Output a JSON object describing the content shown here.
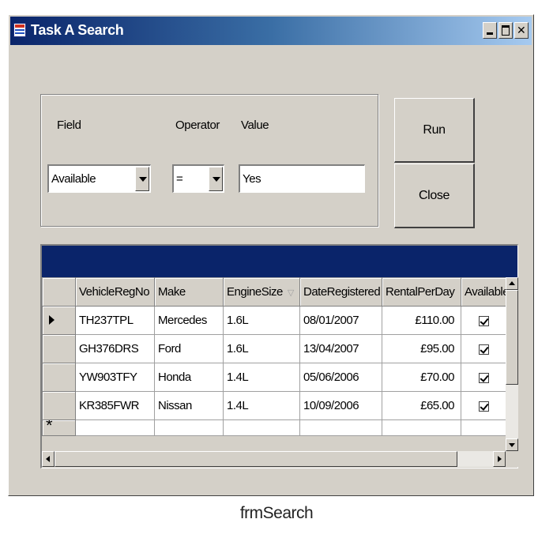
{
  "window": {
    "title": "Task A Search",
    "caption_below": "frmSearch"
  },
  "criteria": {
    "field_label": "Field",
    "operator_label": "Operator",
    "value_label": "Value",
    "field_value": "Available",
    "operator_value": "=",
    "value_value": "Yes"
  },
  "buttons": {
    "run_label": "Run",
    "close_label": "Close"
  },
  "grid": {
    "columns": [
      "VehicleRegNo",
      "Make",
      "EngineSize",
      "DateRegistered",
      "RentalPerDay",
      "Available"
    ],
    "sorted_column": "EngineSize",
    "rows": [
      {
        "reg": "TH237TPL",
        "make": "Mercedes",
        "engine": "1.6L",
        "date": "08/01/2007",
        "rental": "£110.00",
        "available": true
      },
      {
        "reg": "GH376DRS",
        "make": "Ford",
        "engine": "1.6L",
        "date": "13/04/2007",
        "rental": "£95.00",
        "available": true
      },
      {
        "reg": "YW903TFY",
        "make": "Honda",
        "engine": "1.4L",
        "date": "05/06/2006",
        "rental": "£70.00",
        "available": true
      },
      {
        "reg": "KR385FWR",
        "make": "Nissan",
        "engine": "1.4L",
        "date": "10/09/2006",
        "rental": "£65.00",
        "available": true
      }
    ],
    "new_row_glyph": "*"
  },
  "colors": {
    "title_gradient_start": "#0a246a",
    "title_gradient_end": "#a6caf0",
    "window_face": "#d4d0c8",
    "grid_caption": "#0a246a"
  },
  "icons": {
    "app": "form-app-icon",
    "minimize": "minimize-icon",
    "maximize": "maximize-icon",
    "close": "close-icon",
    "dropdown": "chevron-down-icon",
    "current_row": "row-pointer-icon",
    "checked": "checkbox-checked-icon"
  }
}
